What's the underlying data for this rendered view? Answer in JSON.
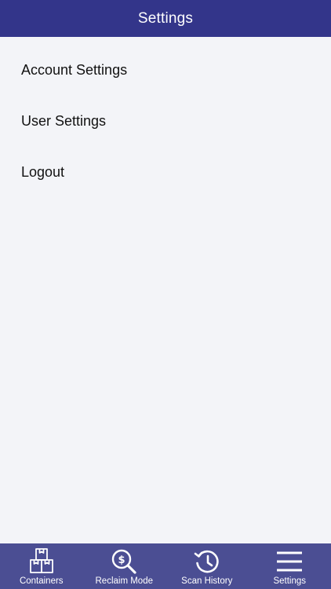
{
  "header": {
    "title": "Settings"
  },
  "menu": {
    "items": [
      {
        "label": "Account Settings"
      },
      {
        "label": "User Settings"
      },
      {
        "label": "Logout"
      }
    ]
  },
  "tabbar": {
    "tabs": [
      {
        "label": "Containers",
        "icon": "boxes-icon"
      },
      {
        "label": "Reclaim Mode",
        "icon": "dollar-search-icon"
      },
      {
        "label": "Scan History",
        "icon": "history-icon"
      },
      {
        "label": "Settings",
        "icon": "hamburger-menu-icon"
      }
    ],
    "active_index": 3
  },
  "colors": {
    "header_bg": "#33358a",
    "tabbar_bg": "#4b4e93",
    "page_bg": "#f3f4f8"
  }
}
